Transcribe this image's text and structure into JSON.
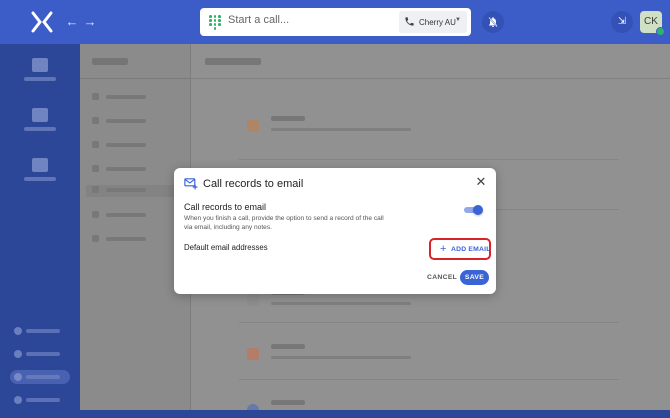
{
  "topbar": {
    "search_placeholder": "Start a call...",
    "caller_id": "Cherry AU",
    "avatar_initials": "CK"
  },
  "modal": {
    "title": "Call records to email",
    "setting_label": "Call records to email",
    "setting_description": "When you finish a call, provide the option to send a record of the call via email, including any notes.",
    "toggle_on": true,
    "default_emails_label": "Default email addresses",
    "add_email_label": "ADD EMAIL",
    "cancel_label": "CANCEL",
    "save_label": "SAVE"
  },
  "colors": {
    "topbar": "#3c5cc8",
    "accent": "#3a63d6",
    "highlight": "#d9232a",
    "presence": "#2fb36b"
  }
}
